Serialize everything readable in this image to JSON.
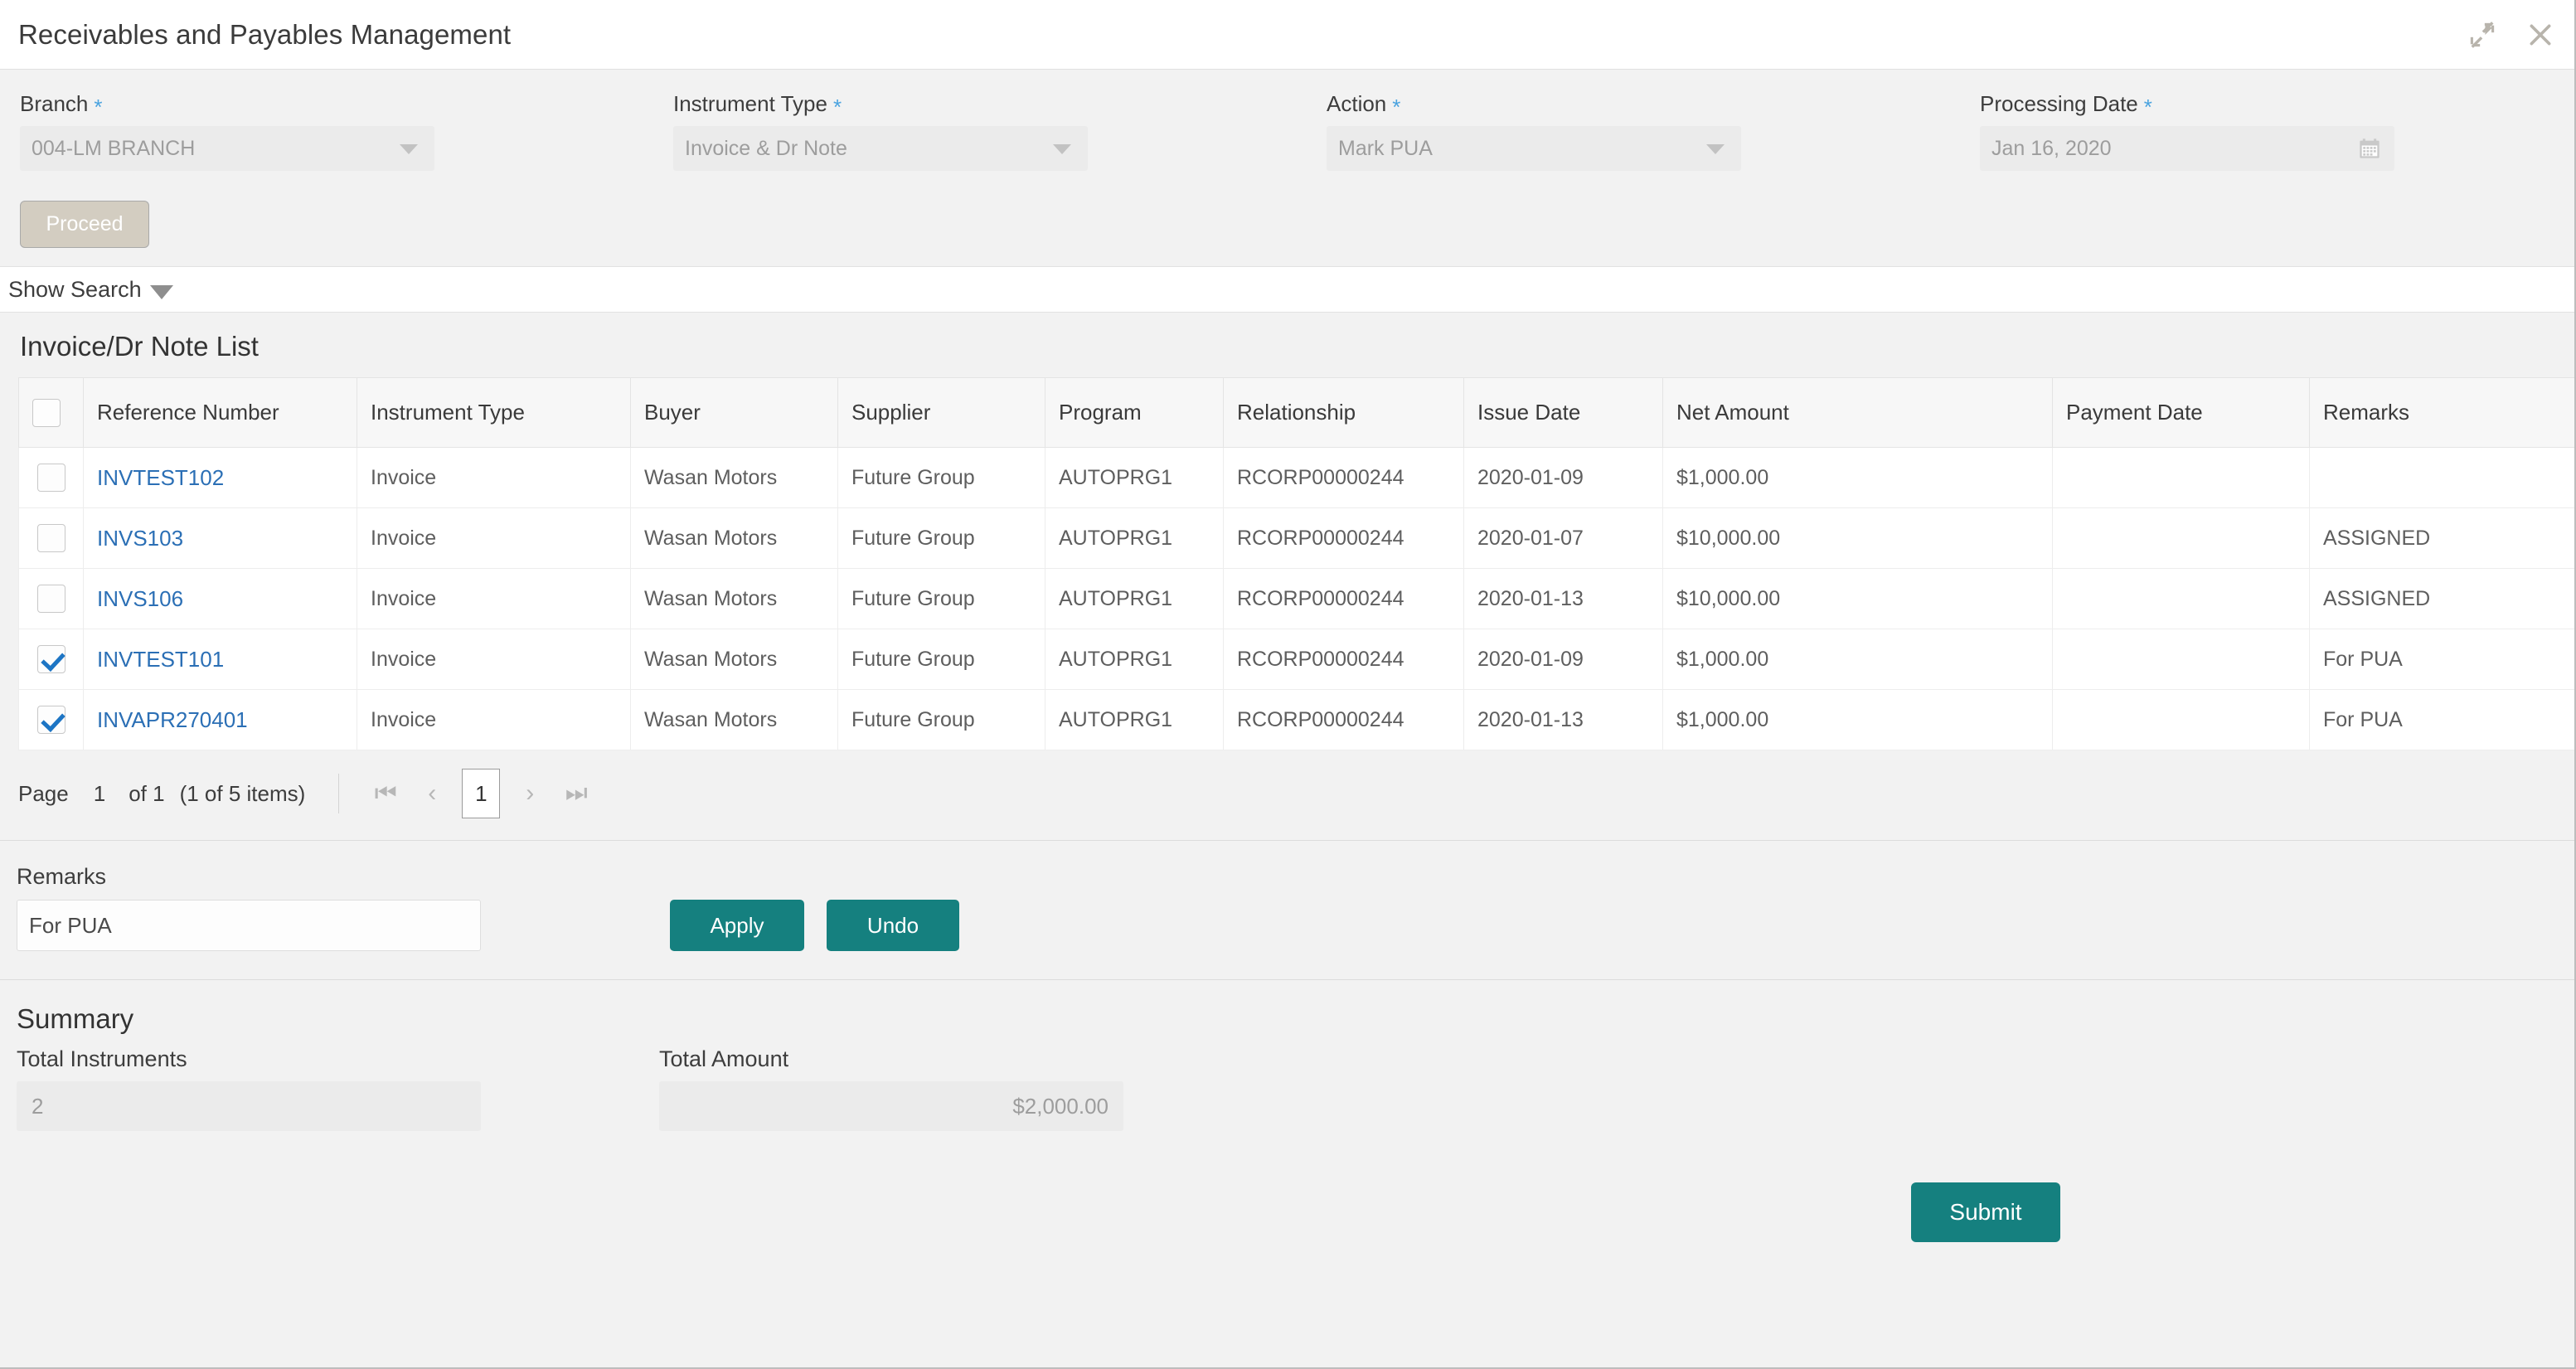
{
  "window": {
    "title": "Receivables and Payables Management",
    "minimize_icon": "collapse-arrows-icon",
    "close_icon": "close-icon"
  },
  "form": {
    "fields": [
      {
        "label": "Branch",
        "required": "*",
        "value": "004-LM BRANCH",
        "icon": "chevron-down-icon"
      },
      {
        "label": "Instrument Type",
        "required": "*",
        "value": "Invoice & Dr Note",
        "icon": "chevron-down-icon"
      },
      {
        "label": "Action",
        "required": "*",
        "value": "Mark PUA",
        "icon": "chevron-down-icon"
      },
      {
        "label": "Processing Date",
        "required": "*",
        "value": "Jan 16, 2020",
        "icon": "calendar-icon"
      }
    ],
    "proceed_label": "Proceed"
  },
  "show_search": {
    "label": "Show Search",
    "icon": "caret-down-icon"
  },
  "list": {
    "title": "Invoice/Dr Note List",
    "columns": [
      "Reference Number",
      "Instrument Type",
      "Buyer",
      "Supplier",
      "Program",
      "Relationship",
      "Issue Date",
      "Net Amount",
      "Payment Date",
      "Remarks"
    ],
    "header_checkbox_checked": false,
    "rows": [
      {
        "checked": false,
        "reference_number": "INVTEST102",
        "instrument_type": "Invoice",
        "buyer": "Wasan Motors",
        "supplier": "Future Group",
        "program": "AUTOPRG1",
        "relationship": "RCORP00000244",
        "issue_date": "2020-01-09",
        "net_amount": "$1,000.00",
        "payment_date": "",
        "remarks": ""
      },
      {
        "checked": false,
        "reference_number": "INVS103",
        "instrument_type": "Invoice",
        "buyer": "Wasan Motors",
        "supplier": "Future Group",
        "program": "AUTOPRG1",
        "relationship": "RCORP00000244",
        "issue_date": "2020-01-07",
        "net_amount": "$10,000.00",
        "payment_date": "",
        "remarks": "ASSIGNED"
      },
      {
        "checked": false,
        "reference_number": "INVS106",
        "instrument_type": "Invoice",
        "buyer": "Wasan Motors",
        "supplier": "Future Group",
        "program": "AUTOPRG1",
        "relationship": "RCORP00000244",
        "issue_date": "2020-01-13",
        "net_amount": "$10,000.00",
        "payment_date": "",
        "remarks": "ASSIGNED"
      },
      {
        "checked": true,
        "reference_number": "INVTEST101",
        "instrument_type": "Invoice",
        "buyer": "Wasan Motors",
        "supplier": "Future Group",
        "program": "AUTOPRG1",
        "relationship": "RCORP00000244",
        "issue_date": "2020-01-09",
        "net_amount": "$1,000.00",
        "payment_date": "",
        "remarks": "For PUA"
      },
      {
        "checked": true,
        "reference_number": "INVAPR270401",
        "instrument_type": "Invoice",
        "buyer": "Wasan Motors",
        "supplier": "Future Group",
        "program": "AUTOPRG1",
        "relationship": "RCORP00000244",
        "issue_date": "2020-01-13",
        "net_amount": "$1,000.00",
        "payment_date": "",
        "remarks": "For PUA"
      }
    ]
  },
  "pagination": {
    "page_word": "Page",
    "current_page": "1",
    "of_label": "of 1",
    "items_label": "(1 of 5 items)",
    "first_icon": "first-page-icon",
    "prev_icon": "previous-page-icon",
    "page_box": "1",
    "next_icon": "next-page-icon",
    "last_icon": "last-page-icon"
  },
  "remarks": {
    "label": "Remarks",
    "value": "For PUA",
    "apply_label": "Apply",
    "undo_label": "Undo"
  },
  "summary": {
    "title": "Summary",
    "total_instruments_label": "Total Instruments",
    "total_instruments_value": "2",
    "total_amount_label": "Total Amount",
    "total_amount_value": "$2,000.00"
  },
  "footer": {
    "submit_label": "Submit"
  },
  "colors": {
    "accent_teal": "#15807F",
    "link_blue": "#2B6FB5",
    "required_star": "#4AA3DF",
    "disabled_button": "#D3CDC1",
    "page_background": "#F2F2F2"
  }
}
